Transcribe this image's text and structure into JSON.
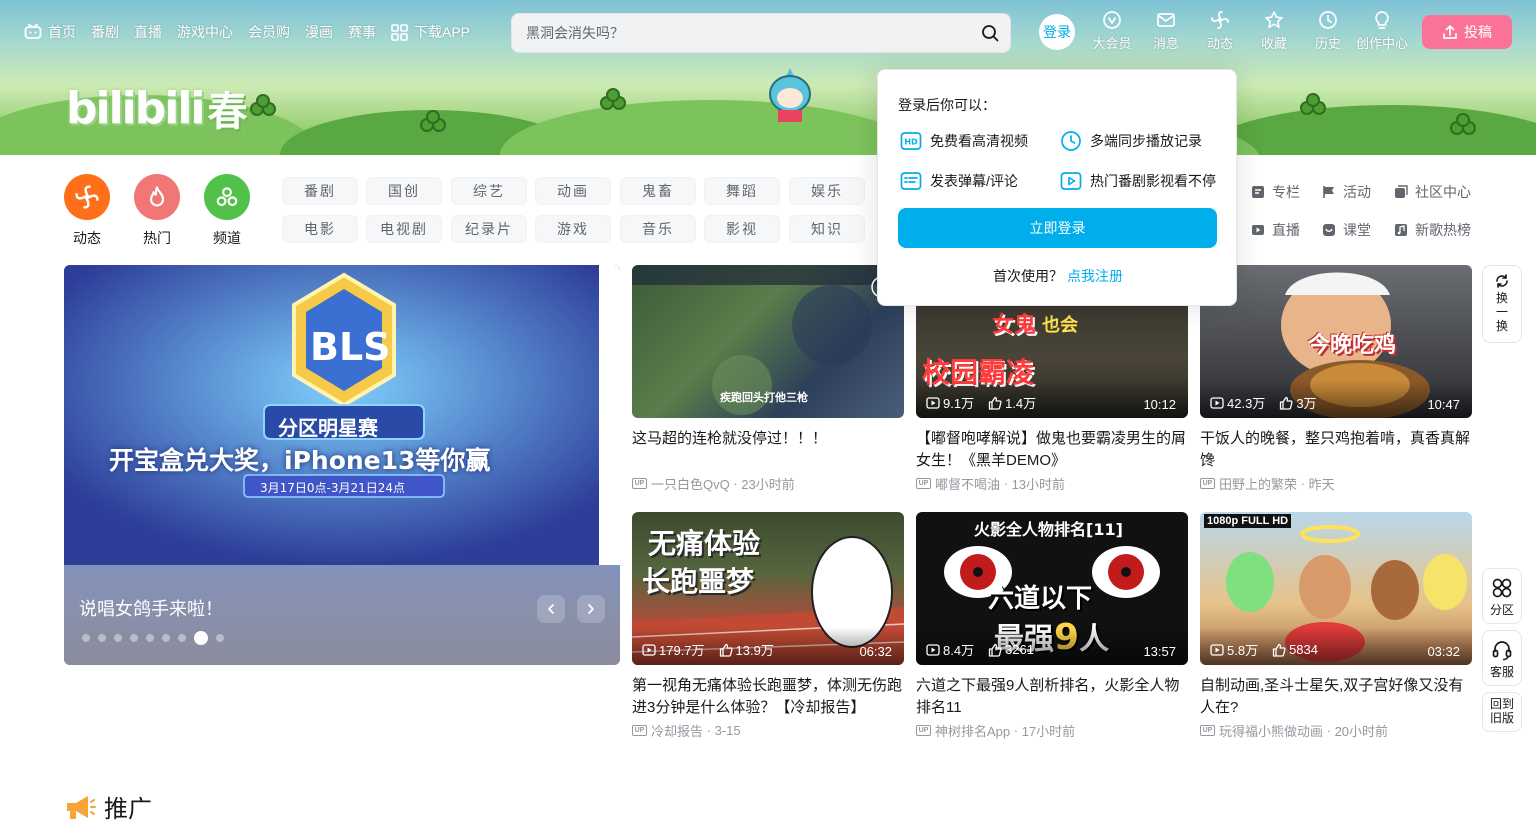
{
  "nav": {
    "items": [
      {
        "label": "首页",
        "icon": "tv-icon"
      },
      {
        "label": "番剧"
      },
      {
        "label": "直播"
      },
      {
        "label": "游戏中心"
      },
      {
        "label": "会员购"
      },
      {
        "label": "漫画"
      },
      {
        "label": "赛事"
      },
      {
        "label": "下载APP",
        "icon": "app-grid-icon"
      }
    ],
    "search_placeholder": "黑洞会消失吗？",
    "login": "登录",
    "right": [
      {
        "label": "大会员",
        "icon": "vip-icon"
      },
      {
        "label": "消息",
        "icon": "message-icon"
      },
      {
        "label": "动态",
        "icon": "dynamic-icon"
      },
      {
        "label": "收藏",
        "icon": "star-icon"
      },
      {
        "label": "历史",
        "icon": "clock-icon"
      },
      {
        "label": "创作中心",
        "icon": "bulb-icon"
      }
    ],
    "submit": "投稿"
  },
  "logo": {
    "text": "bilibili",
    "badge": "春"
  },
  "quick": [
    {
      "label": "动态",
      "color": "#ff6f1a"
    },
    {
      "label": "热门",
      "color": "#f07775"
    },
    {
      "label": "频道",
      "color": "#51c14a"
    }
  ],
  "channels": {
    "row1": [
      "番剧",
      "国创",
      "综艺",
      "动画",
      "鬼畜",
      "舞蹈",
      "娱乐"
    ],
    "row2": [
      "电影",
      "电视剧",
      "纪录片",
      "游戏",
      "音乐",
      "影视",
      "知识"
    ],
    "extra_row1": [
      "专栏",
      "活动",
      "社区中心"
    ],
    "extra_row2": [
      "直播",
      "课堂",
      "新歌热榜"
    ]
  },
  "carousel": {
    "caption": "说唱女鸽手来啦！",
    "image_text": "开宝盒兑大奖，iPhone13等你赢",
    "image_sub": "分区明星赛",
    "image_date": "3月17日0点-3月21日24点",
    "image_logo": "BLS",
    "dots": 9,
    "active_dot": 8
  },
  "videos": [
    {
      "title": "这马超的连枪就没停过！！！",
      "owner": "一只白色QvQ",
      "time": "23小时前",
      "views": "",
      "likes": "",
      "duration": "",
      "thumb_text": "疾跑回头打他三枪"
    },
    {
      "title": "【嘟督咆哮解说】做鬼也要霸凌男生的屑女生！《黑羊DEMO》",
      "owner": "嘟督不喝油",
      "time": "13小时前",
      "views": "9.1万",
      "likes": "1.4万",
      "duration": "10:12",
      "thumb_text": "女鬼也会校园霸凌"
    },
    {
      "title": "干饭人的晚餐，整只鸡抱着啃，真香真解馋",
      "owner": "田野上的繁荣",
      "time": "昨天",
      "views": "42.3万",
      "likes": "3万",
      "duration": "10:47",
      "thumb_text": "今晚吃鸡"
    },
    {
      "title": "第一视角无痛体验长跑噩梦，体测无伤跑进3分钟是什么体验？【冷却报告】",
      "owner": "冷却报告",
      "time": "3-15",
      "views": "179.7万",
      "likes": "13.9万",
      "duration": "06:32",
      "thumb_text": "无痛体验长跑噩梦"
    },
    {
      "title": "六道之下最强9人剖析排名，火影全人物排名11",
      "owner": "神树排名App",
      "time": "17小时前",
      "views": "8.4万",
      "likes": "3261",
      "duration": "13:57",
      "thumb_text": "六道以下最强9人",
      "thumb_top": "火影全人物排名[11]"
    },
    {
      "title": "自制动画,圣斗士星矢,双子宫好像又没有人在?",
      "owner": "玩得福小熊做动画",
      "time": "20小时前",
      "views": "5.8万",
      "likes": "5834",
      "duration": "03:32",
      "thumb_text": "1080p FULL HD"
    }
  ],
  "popup": {
    "title": "登录后你可以：",
    "features": [
      "免费看高清视频",
      "多端同步播放记录",
      "发表弹幕/评论",
      "热门番剧影视看不停"
    ],
    "button": "立即登录",
    "first_use": "首次使用？",
    "register": "点我注册"
  },
  "side": {
    "refresh": "换一换",
    "zone": "分区",
    "service": "客服",
    "old": "回到旧版"
  },
  "promo": {
    "title": "推广"
  }
}
